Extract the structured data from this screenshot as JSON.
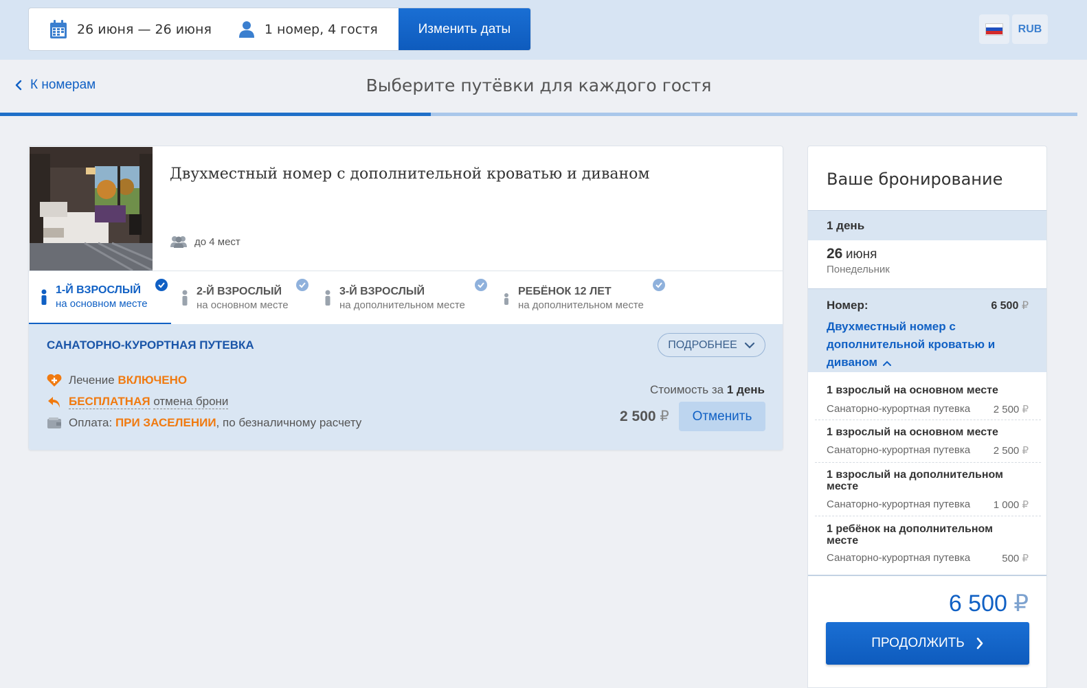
{
  "search": {
    "dates": "26 июня — 26 июня",
    "guests": "1 номер, 4 гостя",
    "change_label": "Изменить даты"
  },
  "locale": {
    "flag_icon": "russia-flag-icon",
    "currency": "RUB"
  },
  "header": {
    "back_label": "К номерам",
    "title": "Выберите путёвки для каждого гостя",
    "progress": 0.4
  },
  "room": {
    "name": "Двухместный номер с дополнительной кроватью и диваном",
    "capacity": "до 4 мест",
    "photo_icon": "room-photo"
  },
  "guest_tabs": [
    {
      "title": "1-Й ВЗРОСЛЫЙ",
      "subtitle": "на основном месте",
      "active": true
    },
    {
      "title": "2-Й ВЗРОСЛЫЙ",
      "subtitle": "на основном месте",
      "active": false
    },
    {
      "title": "3-Й ВЗРОСЛЫЙ",
      "subtitle": "на дополнительном месте",
      "active": false
    },
    {
      "title": "РЕБЁНОК  12 ЛЕТ",
      "subtitle": "на дополнительном месте",
      "active": false
    }
  ],
  "voucher": {
    "title": "САНАТОРНО-КУРОРТНАЯ ПУТЕВКА",
    "more_label": "ПОДРОБНЕЕ",
    "treatment_label": "Лечение",
    "treatment_value": "ВКЛЮЧЕНО",
    "cancel_free": "БЕСПЛАТНАЯ",
    "cancel_rest": "отмена брони",
    "payment_label": "Оплата:",
    "payment_value": "ПРИ ЗАСЕЛЕНИИ",
    "payment_rest": ", по безналичному расчету",
    "cost_label": "Стоимость за",
    "cost_period": "1 день",
    "price": "2 500",
    "currency_sign": "₽",
    "cancel_button": "Отменить"
  },
  "booking": {
    "title": "Ваше бронирование",
    "days": "1 день",
    "date_day": "26",
    "date_month": "июня",
    "weekday": "Понедельник",
    "room_label": "Номер:",
    "room_amount": "6 500",
    "room_name": "Двухместный номер с дополнительной кроватью и диваном",
    "items": [
      {
        "title": "1 взрослый на основном месте",
        "sub": "Санаторно-курортная путевка",
        "price": "2 500"
      },
      {
        "title": "1 взрослый на основном месте",
        "sub": "Санаторно-курортная путевка",
        "price": "2 500"
      },
      {
        "title": "1 взрослый на дополнительном месте",
        "sub": "Санаторно-курортная путевка",
        "price": "1 000"
      },
      {
        "title": "1 ребёнок на дополнительном месте",
        "sub": "Санаторно-курортная путевка",
        "price": "500"
      }
    ],
    "total": "6 500",
    "continue_label": "ПРОДОЛЖИТЬ"
  },
  "colors": {
    "accent": "#1060c4",
    "orange": "#f07a10",
    "topbar": "#d7e4f3",
    "panel": "#dae6f3"
  }
}
